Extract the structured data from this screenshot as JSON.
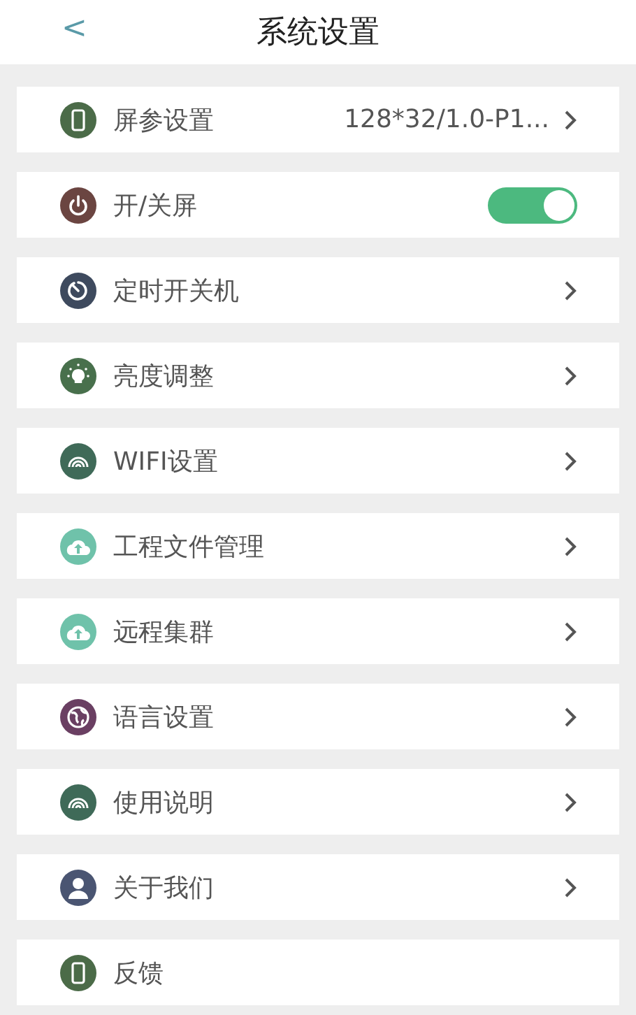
{
  "header": {
    "back": "<",
    "title": "系统设置"
  },
  "items": [
    {
      "label": "屏参设置",
      "color": "#4b6b48",
      "kind": "value",
      "value": "128*32/1.0-P1..."
    },
    {
      "label": "开/关屏",
      "color": "#6b4541",
      "kind": "toggle",
      "on": true
    },
    {
      "label": "定时开关机",
      "color": "#3e4a5e",
      "kind": "link"
    },
    {
      "label": "亮度调整",
      "color": "#48704c",
      "kind": "link"
    },
    {
      "label": "WIFI设置",
      "color": "#3f6a58",
      "kind": "link"
    },
    {
      "label": "工程文件管理",
      "color": "#6fc2aa",
      "kind": "link"
    },
    {
      "label": "远程集群",
      "color": "#6fc2aa",
      "kind": "link"
    },
    {
      "label": "语言设置",
      "color": "#6a3f62",
      "kind": "link"
    },
    {
      "label": "使用说明",
      "color": "#3f6a58",
      "kind": "link"
    },
    {
      "label": "关于我们",
      "color": "#4a5572",
      "kind": "link"
    },
    {
      "label": "反馈",
      "color": "#4b6b48",
      "kind": "plain"
    }
  ]
}
